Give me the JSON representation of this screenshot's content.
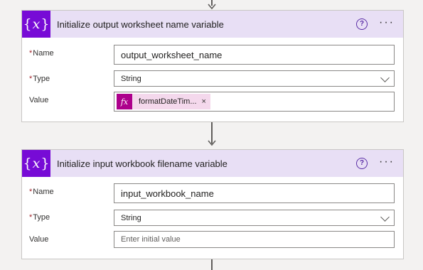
{
  "cards": [
    {
      "title": "Initialize output worksheet name variable",
      "name_label": "Name",
      "name_value": "output_worksheet_name",
      "type_label": "Type",
      "type_value": "String",
      "value_label": "Value",
      "value_token": "formatDateTim...",
      "token_remove": "×"
    },
    {
      "title": "Initialize input workbook filename variable",
      "name_label": "Name",
      "name_value": "input_workbook_name",
      "type_label": "Type",
      "type_value": "String",
      "value_label": "Value",
      "value_placeholder": "Enter initial value"
    }
  ],
  "icons": {
    "variable": "{x}",
    "help": "?",
    "more": "···",
    "fx": "fx",
    "required": "*"
  },
  "colors": {
    "header_bg": "#e8dff5",
    "variable_icon_bg": "#770bd6",
    "fx_icon_bg": "#ad008c",
    "token_bg": "#f4d8ec",
    "required": "#a4262c"
  }
}
